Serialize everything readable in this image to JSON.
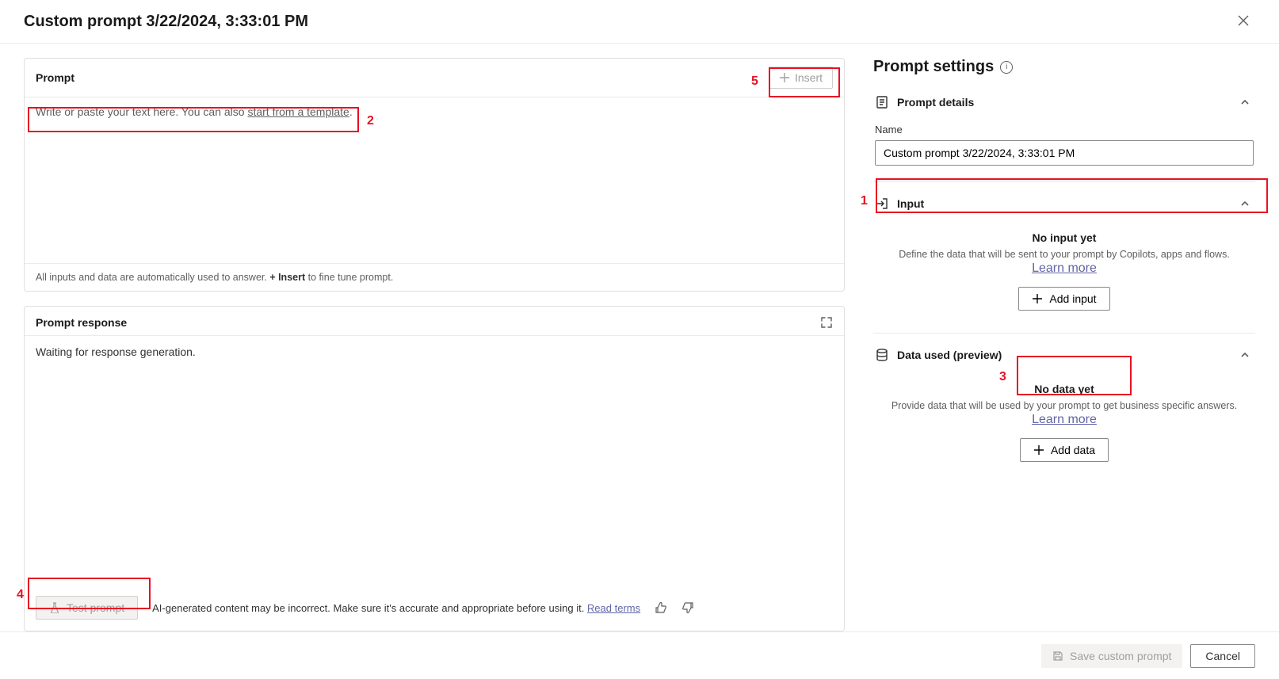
{
  "header": {
    "title": "Custom prompt 3/22/2024, 3:33:01 PM"
  },
  "prompt": {
    "section_label": "Prompt",
    "insert_label": "Insert",
    "placeholder_prefix": "Write or paste your text here. You can also ",
    "template_link": "start from a template",
    "placeholder_suffix": ".",
    "footer_prefix": "All inputs and data are automatically used to answer. ",
    "footer_bold": "+ Insert",
    "footer_suffix": " to fine tune prompt."
  },
  "response": {
    "section_label": "Prompt response",
    "waiting_text": "Waiting for response generation.",
    "test_label": "Test prompt",
    "disclaimer_prefix": "AI-generated content may be incorrect. Make sure it's accurate and appropriate before using it. ",
    "read_terms": "Read terms"
  },
  "settings": {
    "title": "Prompt settings",
    "details": {
      "header": "Prompt details",
      "name_label": "Name",
      "name_value": "Custom prompt 3/22/2024, 3:33:01 PM"
    },
    "input": {
      "header": "Input",
      "empty_title": "No input yet",
      "empty_desc": "Define the data that will be sent to your prompt by Copilots, apps and flows.",
      "learn_more": "Learn more",
      "add_label": "Add input"
    },
    "data": {
      "header": "Data used (preview)",
      "empty_title": "No data yet",
      "empty_desc": "Provide data that will be used by your prompt to get business specific answers.",
      "learn_more": "Learn more",
      "add_label": "Add data"
    }
  },
  "footer": {
    "save_label": "Save custom prompt",
    "cancel_label": "Cancel"
  },
  "annotations": {
    "n1": "1",
    "n2": "2",
    "n3": "3",
    "n4": "4",
    "n5": "5"
  }
}
